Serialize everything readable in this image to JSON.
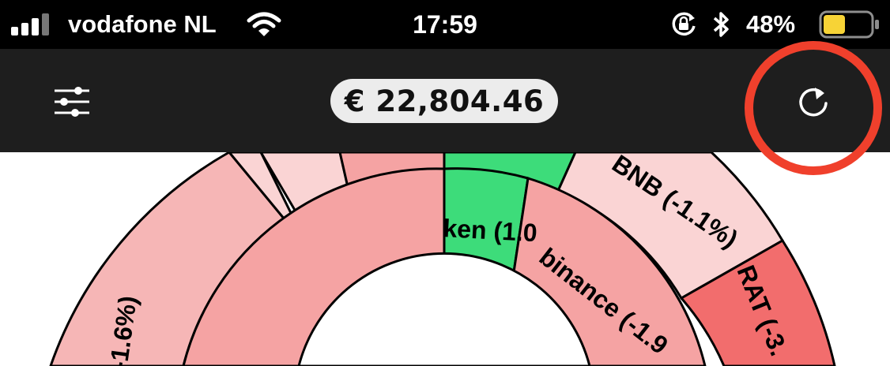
{
  "status_bar": {
    "carrier": "vodafone NL",
    "time": "17:59",
    "battery_percent": "48%",
    "signal_icon": "signal-bars-icon",
    "wifi_icon": "wifi-icon",
    "orientation_lock_icon": "orientation-lock-icon",
    "bluetooth_icon": "bluetooth-icon",
    "battery_icon": "battery-icon",
    "battery_level": 0.48
  },
  "toolbar": {
    "total_balance": "€ 22,804.46",
    "filter_icon": "sliders-icon",
    "refresh_icon": "refresh-icon",
    "annotation_color": "#f0402c"
  },
  "sunburst": {
    "inner_labels": [
      "ken (1.0",
      "binance (-1.9"
    ],
    "outer_labels": [
      "-1.6%)",
      "BNB (-1.1%)",
      "RAT (-3."
    ],
    "colors": {
      "gain": "#3ddc7a",
      "small_loss": "#fad4d4",
      "medium_loss": "#f6b6b6",
      "loss": "#f5a3a3",
      "large_loss": "#f26d6d"
    }
  }
}
